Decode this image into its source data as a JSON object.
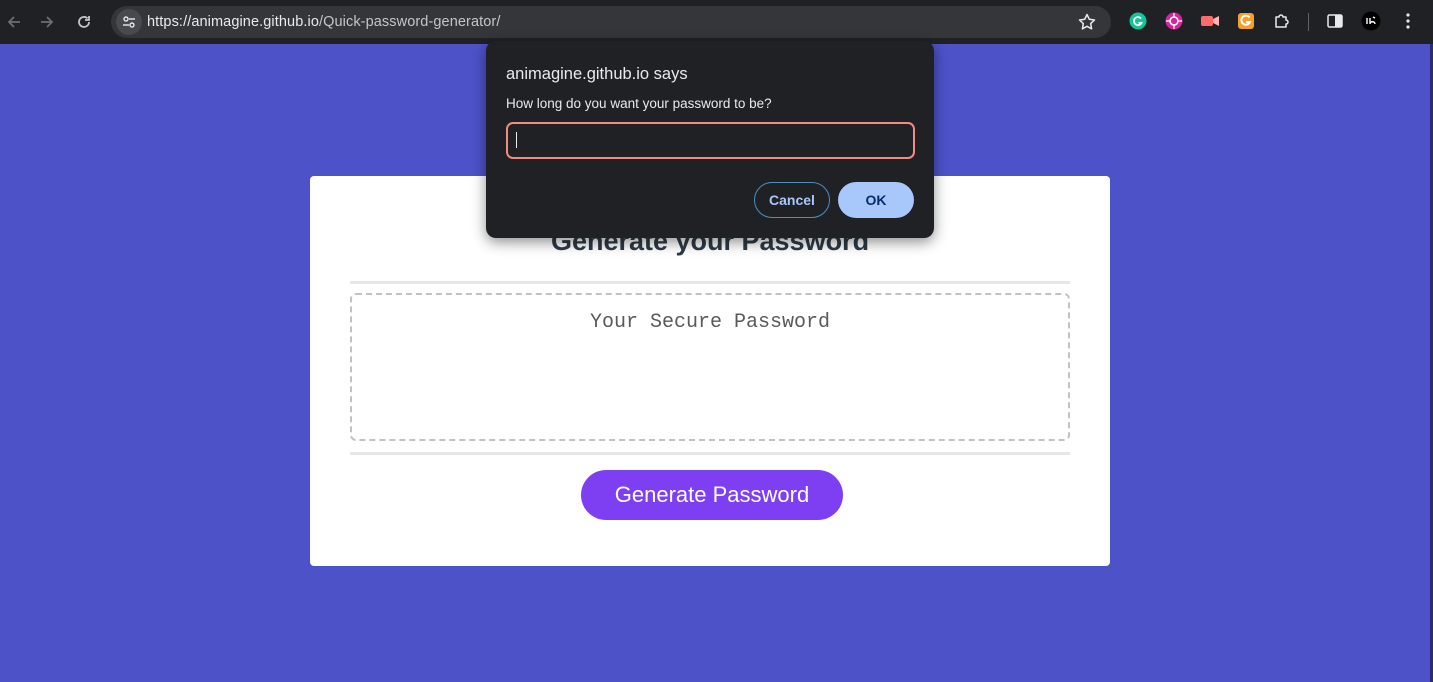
{
  "browser": {
    "url_host": "https://animagine.github.io",
    "url_path": "/Quick-password-generator/",
    "extensions": [
      "grammarly-icon",
      "flower-extension-icon",
      "video-record-icon",
      "g-extension-icon",
      "puzzle-icon"
    ]
  },
  "dialog": {
    "title": "animagine.github.io says",
    "message": "How long do you want your password to be?",
    "input_value": "",
    "cancel_label": "Cancel",
    "ok_label": "OK"
  },
  "card": {
    "title": "Generate your Password",
    "password_placeholder": "Your Secure Password",
    "generate_label": "Generate Password"
  },
  "colors": {
    "page_background": "#4d52c9",
    "generate_button": "#7e3ff2",
    "dialog_background": "#202124",
    "input_focus_border": "#f28b82",
    "ok_button": "#a8c7fa"
  }
}
